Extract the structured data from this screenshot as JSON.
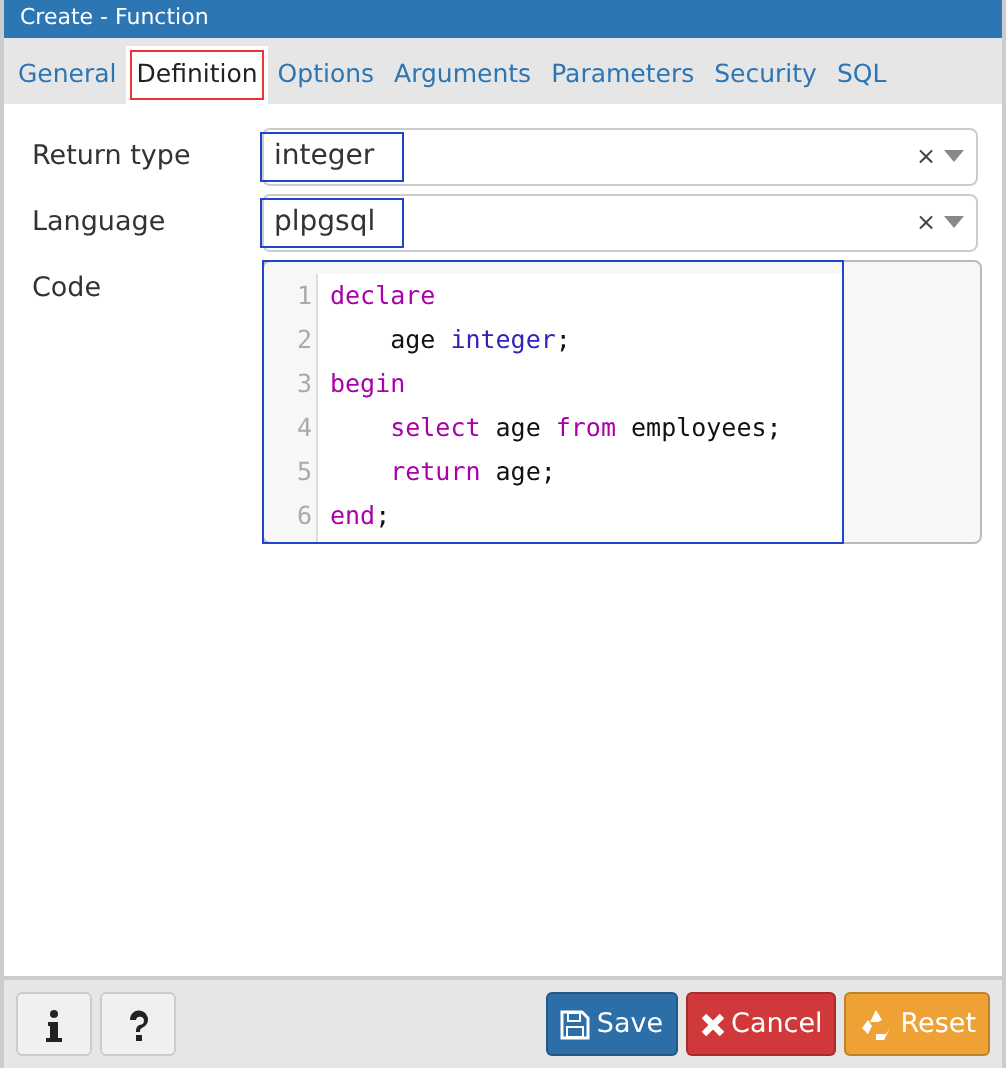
{
  "window": {
    "title": "Create - Function"
  },
  "tabs": [
    {
      "label": "General",
      "selected": false
    },
    {
      "label": "Definition",
      "selected": true
    },
    {
      "label": "Options",
      "selected": false
    },
    {
      "label": "Arguments",
      "selected": false
    },
    {
      "label": "Parameters",
      "selected": false
    },
    {
      "label": "Security",
      "selected": false
    },
    {
      "label": "SQL",
      "selected": false
    }
  ],
  "fields": [
    {
      "label": "Return type",
      "value": "integer",
      "clear": "×",
      "highlighted": true
    },
    {
      "label": "Language",
      "value": "plpgsql",
      "clear": "×",
      "highlighted": true
    }
  ],
  "code": {
    "label": "Code",
    "highlighted": true,
    "lines": [
      {
        "number": "1",
        "indent": false,
        "tokens": [
          {
            "text": "declare",
            "kind": "keyword"
          }
        ]
      },
      {
        "number": "2",
        "indent": true,
        "tokens": [
          {
            "text": "age",
            "kind": "plain"
          },
          {
            "text": "integer",
            "kind": "type"
          },
          {
            "text": ";",
            "kind": "punct"
          }
        ]
      },
      {
        "number": "3",
        "indent": false,
        "tokens": [
          {
            "text": "begin",
            "kind": "keyword"
          }
        ]
      },
      {
        "number": "4",
        "indent": true,
        "tokens": [
          {
            "text": "select",
            "kind": "keyword"
          },
          {
            "text": "age",
            "kind": "plain"
          },
          {
            "text": "from",
            "kind": "keyword"
          },
          {
            "text": "employees",
            "kind": "plain"
          },
          {
            "text": ";",
            "kind": "punct"
          }
        ]
      },
      {
        "number": "5",
        "indent": true,
        "tokens": [
          {
            "text": "return",
            "kind": "keyword"
          },
          {
            "text": "age",
            "kind": "plain"
          },
          {
            "text": ";",
            "kind": "punct"
          }
        ]
      },
      {
        "number": "6",
        "indent": false,
        "tokens": [
          {
            "text": "end",
            "kind": "keyword"
          },
          {
            "text": ";",
            "kind": "punct"
          }
        ]
      }
    ]
  },
  "footer": {
    "left_buttons": [
      {
        "kind": "info"
      },
      {
        "kind": "help"
      }
    ],
    "buttons": [
      {
        "label": "Save",
        "kind": "save"
      },
      {
        "label": "Cancel",
        "kind": "cancel"
      },
      {
        "label": "Reset",
        "kind": "reset"
      }
    ]
  }
}
